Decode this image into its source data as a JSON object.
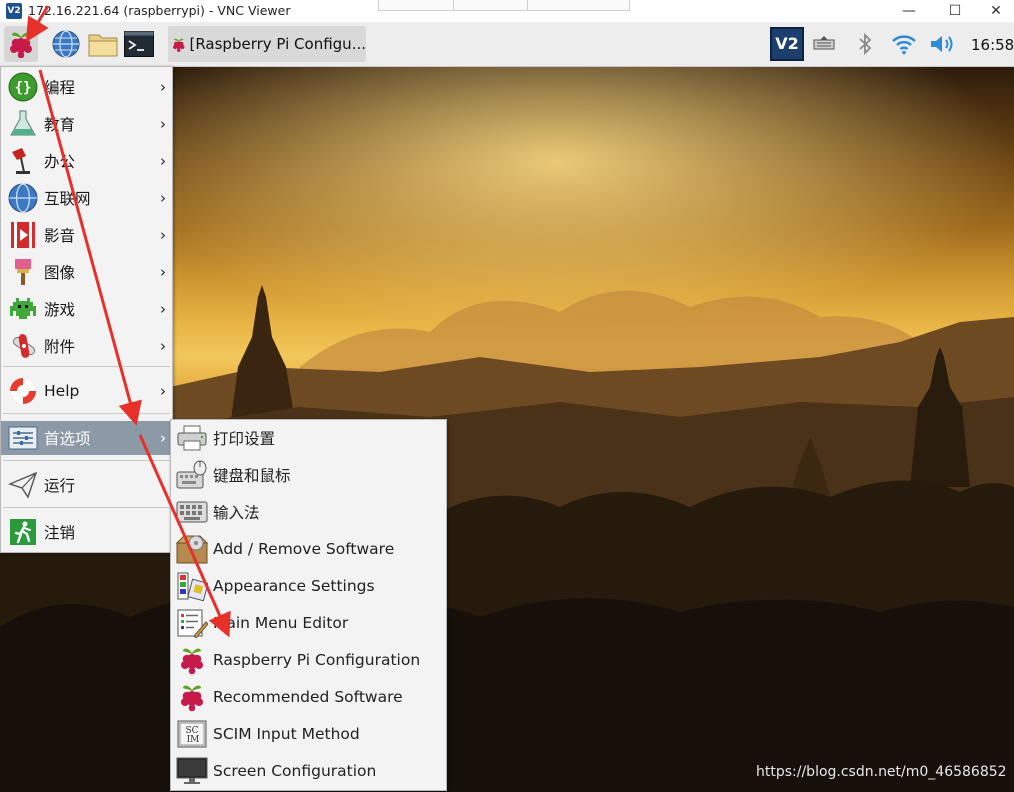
{
  "window": {
    "title": "172.16.221.64 (raspberrypi) - VNC Viewer",
    "logo_text": "V2",
    "minimize": "—",
    "maximize": "☐",
    "close": "✕"
  },
  "panel": {
    "task_label": "[Raspberry Pi Configu...",
    "tray_vnc_text": "V2",
    "clock": "16:58"
  },
  "main_menu": [
    {
      "label": "编程",
      "icon": "programming-icon",
      "has_submenu": true
    },
    {
      "label": "教育",
      "icon": "education-icon",
      "has_submenu": true
    },
    {
      "label": "办公",
      "icon": "office-icon",
      "has_submenu": true
    },
    {
      "label": "互联网",
      "icon": "internet-icon",
      "has_submenu": true
    },
    {
      "label": "影音",
      "icon": "sound-video-icon",
      "has_submenu": true
    },
    {
      "label": "图像",
      "icon": "graphics-icon",
      "has_submenu": true
    },
    {
      "label": "游戏",
      "icon": "games-icon",
      "has_submenu": true
    },
    {
      "label": "附件",
      "icon": "accessories-icon",
      "has_submenu": true
    },
    {
      "label": "Help",
      "icon": "help-icon",
      "has_submenu": true
    },
    {
      "label": "首选项",
      "icon": "preferences-icon",
      "has_submenu": true,
      "highlighted": true
    },
    {
      "label": "运行",
      "icon": "run-icon",
      "has_submenu": false
    },
    {
      "label": "注销",
      "icon": "logout-icon",
      "has_submenu": false
    }
  ],
  "submenu": [
    {
      "label": "打印设置",
      "icon": "printer-icon"
    },
    {
      "label": "键盘和鼠标",
      "icon": "keyboard-mouse-icon"
    },
    {
      "label": "输入法",
      "icon": "input-method-icon"
    },
    {
      "label": "Add / Remove Software",
      "icon": "package-icon"
    },
    {
      "label": "Appearance Settings",
      "icon": "appearance-icon"
    },
    {
      "label": "Main Menu Editor",
      "icon": "menu-editor-icon"
    },
    {
      "label": "Raspberry Pi Configuration",
      "icon": "raspberry-icon"
    },
    {
      "label": "Recommended Software",
      "icon": "raspberry-icon"
    },
    {
      "label": "SCIM Input Method",
      "icon": "scim-icon"
    },
    {
      "label": "Screen Configuration",
      "icon": "monitor-icon"
    }
  ],
  "watermark": "https://blog.csdn.net/m0_46586852",
  "colors": {
    "highlight": "#8c9aa7",
    "annotation_arrow": "#e8302a",
    "raspberry": "#c51a4a"
  }
}
